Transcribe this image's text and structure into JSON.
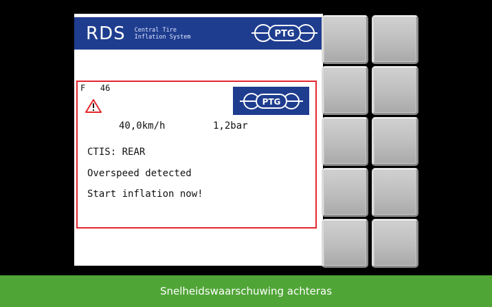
{
  "header": {
    "brand": "RDS",
    "subtitle_line1": "Central Tire",
    "subtitle_line2": "Inflation System",
    "logo_text": "PTG"
  },
  "alarm": {
    "fault_prefix": "F",
    "fault_code": "46",
    "warning_icon": "warning-triangle-icon",
    "logo_text": "PTG",
    "speed": "40,0km/h",
    "pressure": "1,2bar",
    "messages": [
      "CTIS: REAR",
      "Overspeed detected",
      "Start inflation now!"
    ]
  },
  "softkeys": {
    "count": 10
  },
  "caption": "Snelheidswaarschuwing achteras",
  "colors": {
    "banner_blue": "#1f3d8f",
    "alarm_red": "#e3262c",
    "caption_green": "#50a537",
    "bezel_black": "#000000"
  }
}
